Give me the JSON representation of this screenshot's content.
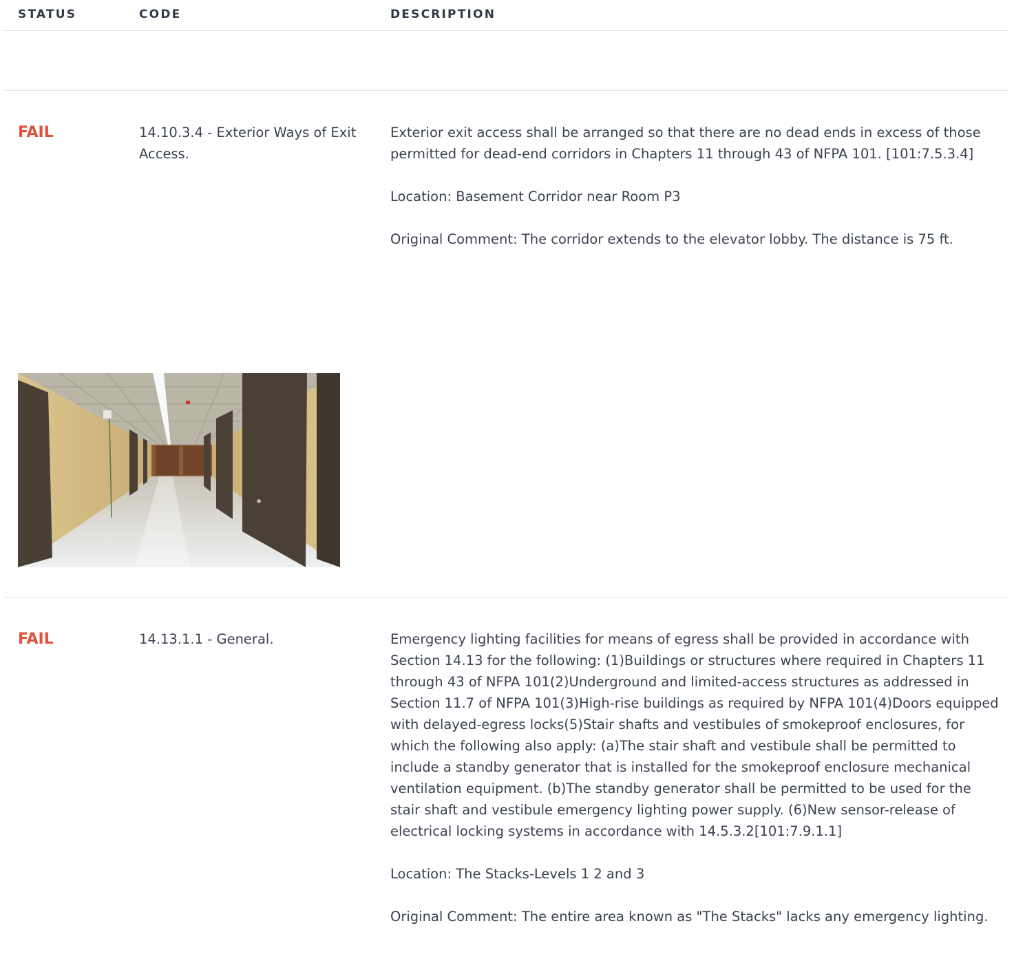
{
  "header": {
    "status": "STATUS",
    "code": "CODE",
    "description": "DESCRIPTION"
  },
  "rows": [
    {
      "status": "FAIL",
      "code": "14.10.3.4 - Exterior Ways of Exit Access.",
      "description": "Exterior exit access shall be arranged so that there are no dead ends in excess of those permitted for dead-end corridors in Chapters 11 through 43 of NFPA 101. [101:7.5.3.4]",
      "location": "Location: Basement Corridor near Room P3",
      "comment": "Original Comment: The corridor extends to the elevator lobby. The distance is 75 ft.",
      "photo": "corridor-photo"
    },
    {
      "status": "FAIL",
      "code": "14.13.1.1 - General.",
      "description": "Emergency lighting facilities for means of egress shall be provided in accordance with Section 14.13 for the following: (1)Buildings or structures where required in Chapters 11 through 43 of NFPA 101(2)Underground and limited-access structures as addressed in Section 11.7 of NFPA 101(3)High-rise buildings as required by NFPA 101(4)Doors equipped with delayed-egress locks(5)Stair shafts and vestibules of smokeproof enclosures, for which the following also apply: (a)The stair shaft and vestibule shall be permitted to include a standby generator that is installed for the smokeproof enclosure mechanical ventilation equipment. (b)The standby generator shall be permitted to be used for the stair shaft and vestibule emergency lighting power supply. (6)New sensor-release of electrical locking systems in accordance with 14.5.3.2[101:7.9.1.1]",
      "location": "Location: The Stacks-Levels 1 2 and 3",
      "comment": "Original Comment: The entire area known as \"The Stacks\" lacks any emergency lighting."
    }
  ],
  "colors": {
    "fail": "#e0533a",
    "text": "#3a4150",
    "header": "#323a48",
    "divider": "#e3e5e8"
  }
}
